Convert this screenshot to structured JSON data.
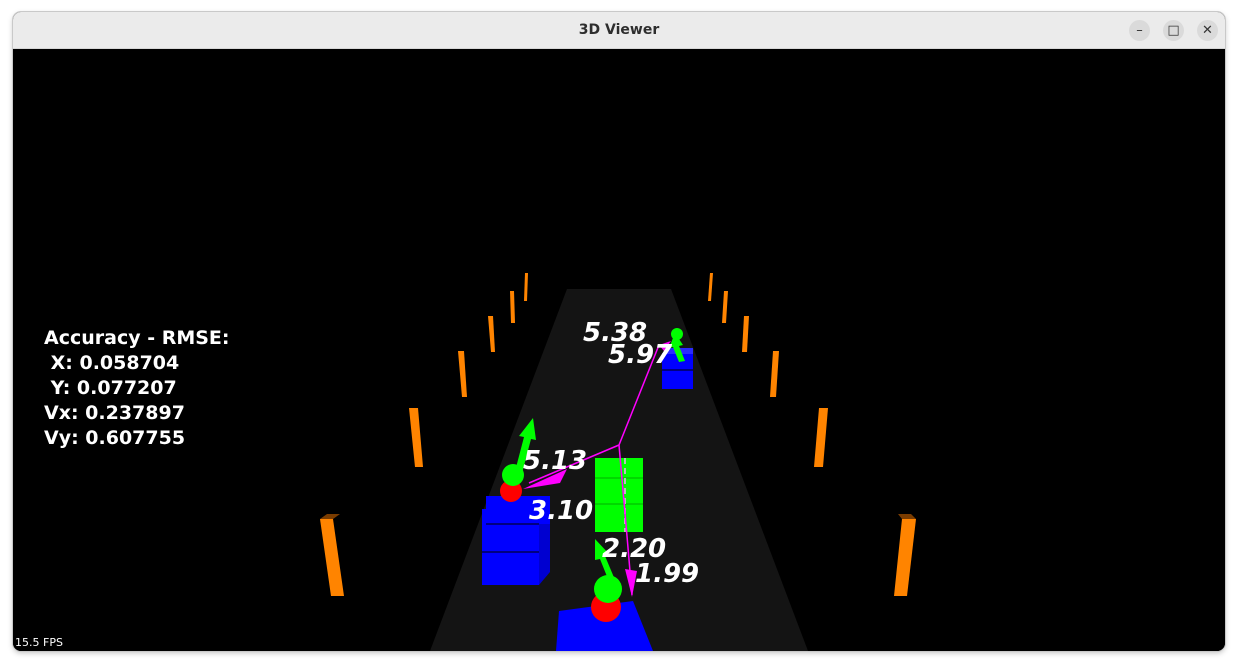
{
  "window": {
    "title": "3D Viewer",
    "minimize_glyph": "–",
    "maximize_glyph": "□",
    "close_glyph": "✕"
  },
  "hud": {
    "heading": "Accuracy - RMSE:",
    "x": " X: 0.058704",
    "y": " Y: 0.077207",
    "vx": "Vx: 0.237897",
    "vy": "Vy: 0.607755"
  },
  "fps": "15.5 FPS",
  "labels": {
    "far_a": "5.38",
    "far_b": "5.97",
    "left_a": "5.13",
    "left_b": "3.10",
    "near_a": "2.20",
    "near_b": "1.99"
  },
  "colors": {
    "road": "#141414",
    "pole": "#ff8400",
    "ego": "#00ff00",
    "car": "#0000ff",
    "track": "#ff00ff",
    "sphere_red": "#ff0000",
    "sphere_green": "#00ff00"
  }
}
